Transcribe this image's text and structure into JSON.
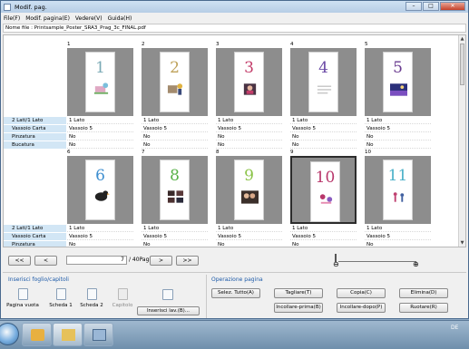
{
  "window": {
    "title": "Modif. pag."
  },
  "menu": [
    {
      "label": "File(F)"
    },
    {
      "label": "Modif. pagina(E)"
    },
    {
      "label": "Vedere(V)"
    },
    {
      "label": "Guida(H)"
    }
  ],
  "file_name": "Nome file : Printsample_Poster_SRA3_Prag_3c_FINAL.pdf",
  "row_labels": [
    "2 Lati/1 Lato",
    "Vassoio Carta",
    "Pinzatura",
    "Bucatura"
  ],
  "pages_row1": [
    {
      "num": "1",
      "digit": "1",
      "digit_color": "#7aa9b5",
      "sides": "1 Lato",
      "tray": "Vassoio 5",
      "staple": "No",
      "punch": "No"
    },
    {
      "num": "2",
      "digit": "2",
      "digit_color": "#bfa25a",
      "sides": "1 Lato",
      "tray": "Vassoio 5",
      "staple": "No",
      "punch": "No"
    },
    {
      "num": "3",
      "digit": "3",
      "digit_color": "#c33d6a",
      "sides": "1 Lato",
      "tray": "Vassoio 5",
      "staple": "No",
      "punch": "No"
    },
    {
      "num": "4",
      "digit": "4",
      "digit_color": "#6b4aa6",
      "sides": "1 Lato",
      "tray": "Vassoio 5",
      "staple": "No",
      "punch": "No"
    },
    {
      "num": "5",
      "digit": "5",
      "digit_color": "#6a3c90",
      "sides": "1 Lato",
      "tray": "Vassoio 5",
      "staple": "No",
      "punch": "No"
    }
  ],
  "pages_row2": [
    {
      "num": "6",
      "digit": "6",
      "digit_color": "#3f8fd0",
      "sides": "1 Lato",
      "tray": "Vassoio 5",
      "staple": "No"
    },
    {
      "num": "7",
      "digit": "8",
      "digit_color": "#56b046",
      "sides": "1 Lato",
      "tray": "Vassoio 5",
      "staple": "No"
    },
    {
      "num": "8",
      "digit": "9",
      "digit_color": "#8cc44a",
      "sides": "1 Lato",
      "tray": "Vassoio 5",
      "staple": "No"
    },
    {
      "num": "9",
      "digit": "10",
      "digit_color": "#b8376b",
      "sides": "1 Lato",
      "tray": "Vassoio 5",
      "staple": "No"
    },
    {
      "num": "10",
      "digit": "11",
      "digit_color": "#4ab0c8",
      "sides": "1 Lato",
      "tray": "Vassoio 5",
      "staple": "No"
    }
  ],
  "selected_page": "9",
  "navigation": {
    "first": "<<",
    "prev": "<",
    "page_value": "7",
    "total": "/ 40Pagina",
    "next": ">",
    "last": ">>"
  },
  "zoom": {
    "out_icon": "zoom-out-icon",
    "in_icon": "zoom-in-icon"
  },
  "insert_group": {
    "title": "Inserisci foglio/capitoli",
    "items": [
      {
        "label": "Pagina vuota",
        "icon": "blank-page-icon"
      },
      {
        "label": "Scheda 1",
        "icon": "tab-sheet-icon"
      },
      {
        "label": "Scheda 2",
        "icon": "tab-sheet-icon"
      },
      {
        "label": "Capitolo",
        "icon": "chapter-icon"
      }
    ],
    "insert_button": "Inserisci lav.(B)..."
  },
  "operation_group": {
    "title": "Operazione pagina",
    "select_all": "Selez. Tutto(A)",
    "cut": "Tagliare(T)",
    "copy": "Copia(C)",
    "delete": "Elimina(D)",
    "paste_before": "Incollare-prima(B)",
    "paste_after": "Incollare-dopo(P)",
    "rotate": "Ruotare(R)"
  },
  "taskbar": {
    "lang": "DE"
  },
  "colors": {
    "label_bg": "#d2e6f5",
    "group_title": "#1d5aa8",
    "selection_border": "#2c2c2c"
  }
}
